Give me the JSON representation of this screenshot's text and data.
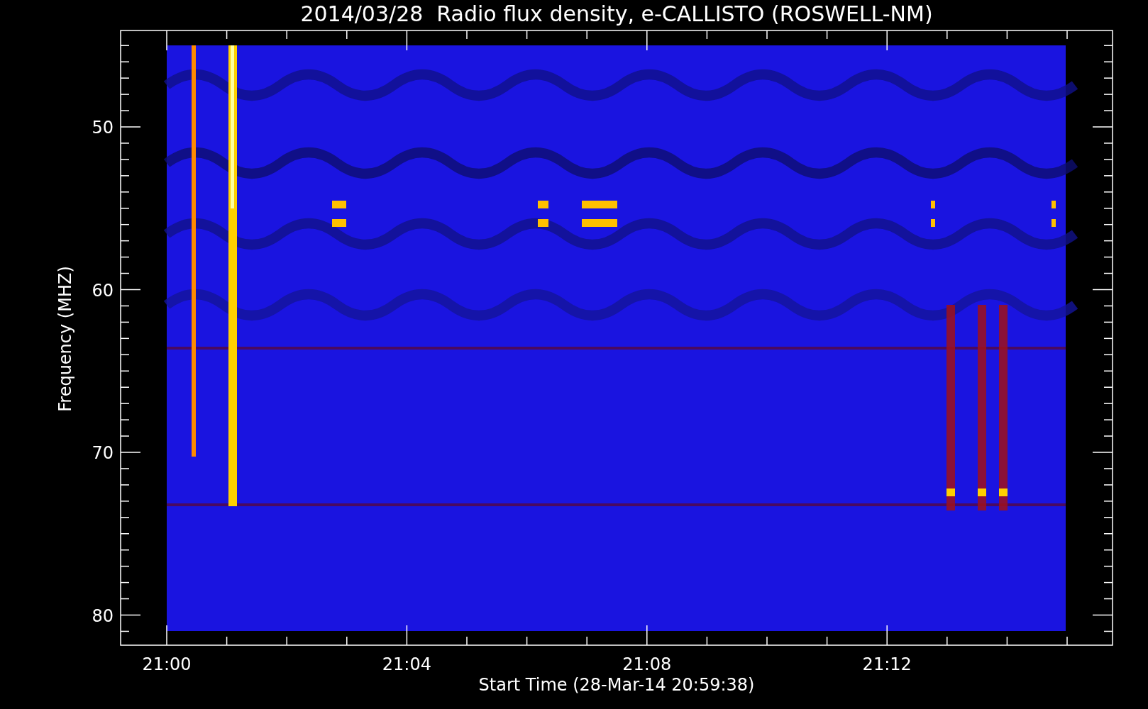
{
  "title": "2014/03/28  Radio flux density, e-CALLISTO (ROSWELL-NM)",
  "y_axis": {
    "label": "Frequency (MHZ)",
    "ticks": [
      "50",
      "60",
      "70",
      "80"
    ]
  },
  "x_axis": {
    "label": "Start Time (28-Mar-14 20:59:38)",
    "ticks": [
      "21:00",
      "21:04",
      "21:08",
      "21:12"
    ]
  }
}
